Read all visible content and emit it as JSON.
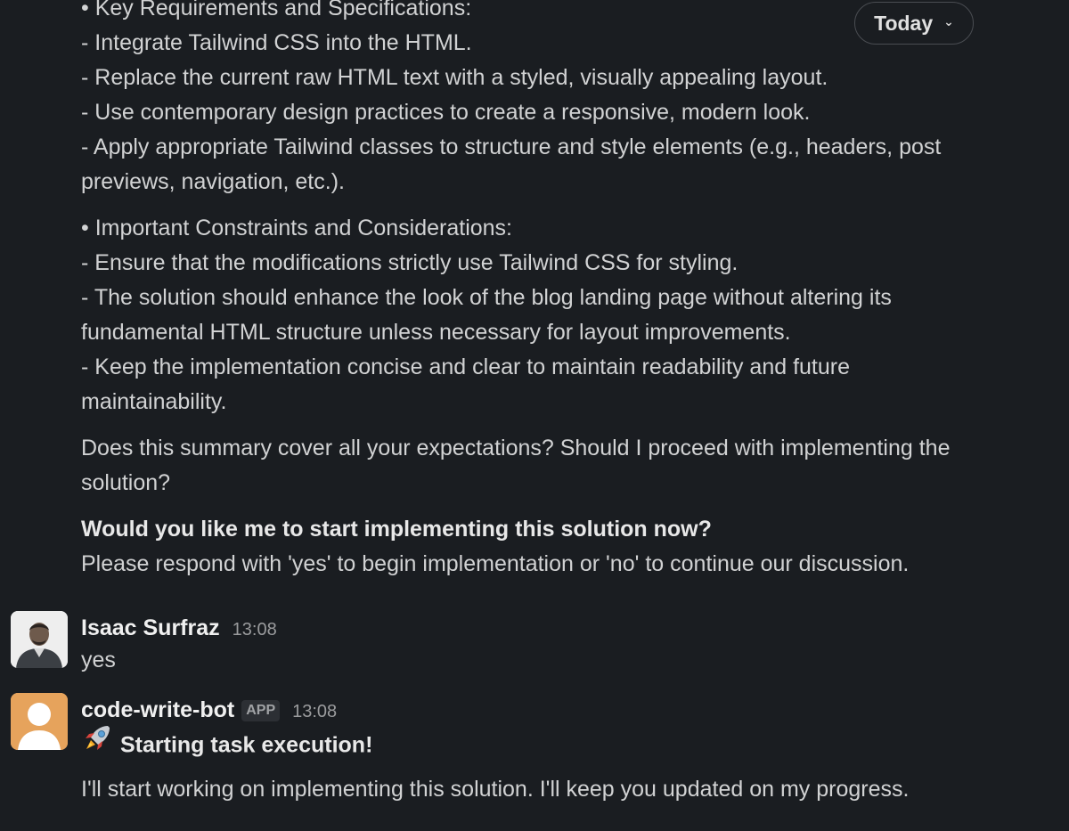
{
  "date_divider": {
    "label": "Today"
  },
  "previous_message": {
    "lines": [
      "• Key Requirements and Specifications:",
      " - Integrate Tailwind CSS into the HTML.",
      " - Replace the current raw HTML text with a styled, visually appealing layout.",
      " - Use contemporary design practices to create a responsive, modern look.",
      " - Apply appropriate Tailwind classes to structure and style elements (e.g., headers, post",
      "previews, navigation, etc.).",
      "• Important Constraints and Considerations:",
      " - Ensure that the modifications strictly use Tailwind CSS for styling.",
      " - The solution should enhance the look of the blog landing page without altering its",
      "fundamental HTML structure unless necessary for layout improvements.",
      " - Keep the implementation concise and clear to maintain readability and future",
      "maintainability.",
      "Does this summary cover all your expectations? Should I proceed with implementing the",
      "solution?",
      "Would you like me to start implementing this solution now?",
      "Please respond with 'yes' to begin implementation or 'no' to continue our discussion."
    ]
  },
  "user_message": {
    "sender": "Isaac Surfraz",
    "time": "13:08",
    "text": "yes"
  },
  "bot_message": {
    "sender": "code-write-bot",
    "badge": "APP",
    "time": "13:08",
    "icon": "rocket-emoji",
    "heading": "Starting task execution!",
    "text": "I'll start working on implementing this solution. I'll keep you updated on my progress."
  }
}
